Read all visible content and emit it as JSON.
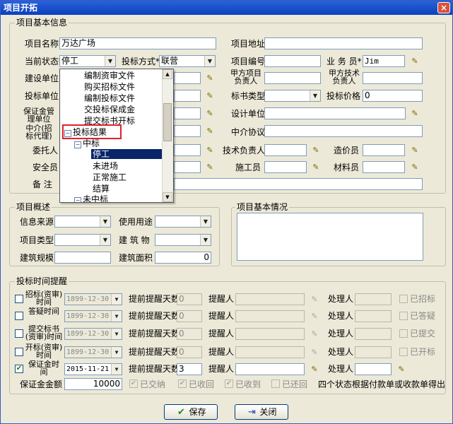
{
  "window": {
    "title": "项目开拓",
    "close": "×"
  },
  "basic": {
    "legend": "项目基本信息",
    "name_label": "项目名称*",
    "name_value": "万达广场",
    "status_label": "当前状态*",
    "status_value": "停工",
    "bid_mode_label": "投标方式*",
    "bid_mode_value": "联营",
    "address_label": "项目地址",
    "address_value": "",
    "project_no_label": "项目编号",
    "project_no_value": "",
    "salesman_label": "业 务 员*",
    "salesman_value": "Jim",
    "build_unit_label": "建设单位",
    "pm_label": "甲方项目负责人",
    "tech_label": "甲方技术负责人",
    "bid_unit_label": "投标单位",
    "doc_type_label": "标书类型",
    "bid_price_label": "投标价格",
    "bid_price_value": "0",
    "deposit_label": "保证金管理单位",
    "design_unit_label": "设计单位",
    "agent_label": "中介(招标代理)",
    "agent_protocol_label": "中介协议",
    "client_label": "委托人",
    "tech_lead_label": "技术负责人",
    "cost_label": "造价员",
    "safety_label": "安全员",
    "builder_label": "施工员",
    "material_label": "材料员",
    "remark_label": "备 注"
  },
  "tree": {
    "items": [
      "编制资审文件",
      "购买招标文件",
      "编制投标文件",
      "交投标保成金",
      "提交标书开标",
      "投标结果",
      "中标",
      "停工",
      "未进场",
      "正常施工",
      "结算",
      "未中标"
    ],
    "toggle_expanded": "−"
  },
  "overview": {
    "legend": "项目概述",
    "source_label": "信息来源",
    "usage_label": "使用用途",
    "type_label": "项目类型",
    "building_label": "建 筑 物",
    "scale_label": "建筑规模",
    "area_label": "建筑面积",
    "area_value": "0"
  },
  "situation": {
    "legend": "项目基本情况"
  },
  "reminder": {
    "legend": "投标时间提醒",
    "advance_label": "提前提醒天数",
    "reminder_label": "提醒人",
    "handler_label": "处理人",
    "rows": [
      {
        "label": "招标(资审)时间",
        "date": "1899-12-30",
        "days": "0",
        "done": "已招标",
        "checked": ""
      },
      {
        "label": "答疑时间",
        "date": "1899-12-30",
        "days": "0",
        "done": "已答疑",
        "checked": ""
      },
      {
        "label": "提交标书(资审)时间",
        "date": "1899-12-30",
        "days": "0",
        "done": "已提交",
        "checked": ""
      },
      {
        "label": "开标(资审)时间",
        "date": "1899-12-30",
        "days": "0",
        "done": "已开标",
        "checked": ""
      },
      {
        "label": "保证金时间",
        "date": "2015-11-21",
        "days": "3",
        "done": "",
        "checked": "✔"
      }
    ],
    "deposit_amount_label": "保证金金额",
    "deposit_amount_value": "10000",
    "paid": "已交纳",
    "received_back": "已收回",
    "received": "已收到",
    "returned": "已还回",
    "note": "四个状态根据付款单或收款单得出"
  },
  "buttons": {
    "save": "保存",
    "close": "关闭"
  },
  "icons": {
    "pick": "✎",
    "combo_arrow": "▼",
    "check": "✔",
    "save_icon": "✔",
    "close_icon": "⇥",
    "scroll_up": "▲",
    "scroll_down": "▼"
  }
}
